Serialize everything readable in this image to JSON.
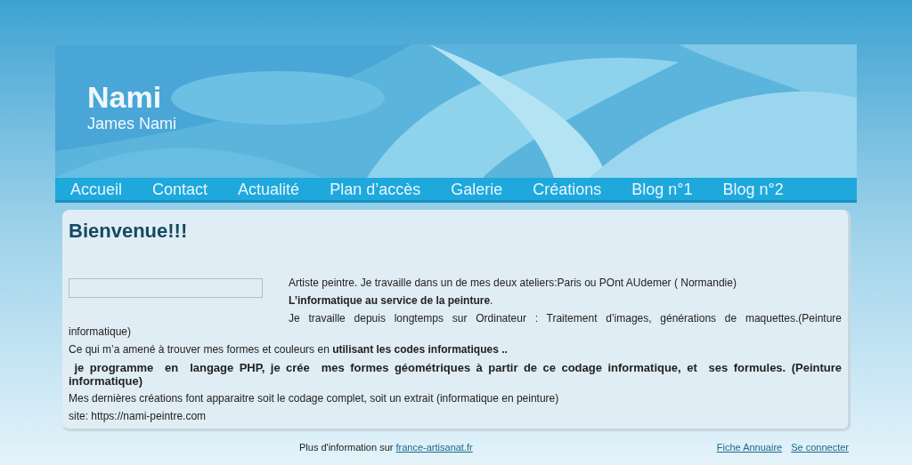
{
  "header": {
    "title": "Nami",
    "subtitle": "James Nami"
  },
  "nav": [
    "Accueil",
    "Contact",
    "Actualité",
    "Plan d’accès",
    "Galerie",
    "Créations",
    "Blog n°1",
    "Blog n°2"
  ],
  "content": {
    "heading": "Bienvenue!!!",
    "paragraphs": [
      {
        "kind": "beside",
        "text": "Artiste peintre. Je travaille dans un de mes deux ateliers:Paris ou POnt AUdemer ( Normandie)"
      },
      {
        "kind": "beside",
        "text": "**L’informatique au service de la peinture**."
      },
      {
        "kind": "justified",
        "text": "Je travaille depuis longtemps sur Ordinateur : Traitement d’images, générations de maquettes.(Peinture informatique)"
      },
      {
        "kind": "plain",
        "text": "Ce qui m’a amené à trouver  mes formes et couleurs en **utilisant les codes informatiques ..**"
      },
      {
        "kind": "bold",
        "text": " je programme  en  langage PHP, je crée  mes formes géométriques à partir de ce codage informatique, et  ses formules. (Peinture informatique)"
      },
      {
        "kind": "plain",
        "text": "Mes dernières créations font apparaitre soit le codage complet, soit un extrait (informatique en peinture)"
      },
      {
        "kind": "plain",
        "text": "site: https://nami-peintre.com"
      }
    ]
  },
  "footer": {
    "info": "Plus d'information sur",
    "info_link": "france-artisanat.fr",
    "links": [
      "Fiche Annuaire",
      "Se connecter"
    ]
  }
}
